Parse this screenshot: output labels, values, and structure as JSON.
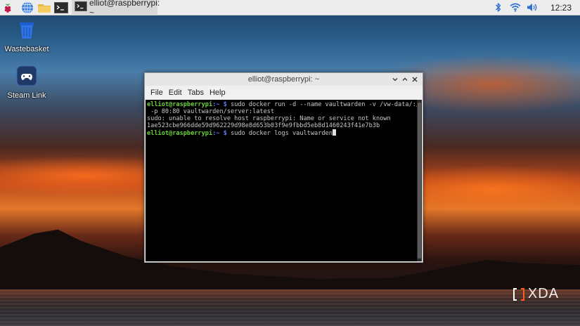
{
  "taskbar": {
    "launchers": [
      {
        "icon": "raspberry-menu-icon"
      },
      {
        "icon": "web-browser-icon"
      },
      {
        "icon": "file-manager-icon"
      },
      {
        "icon": "terminal-icon"
      }
    ],
    "task": {
      "label": "elliot@raspberrypi: ~",
      "icon": "terminal-icon"
    },
    "tray": {
      "bluetooth_icon": "bluetooth-icon",
      "wifi_icon": "wifi-icon",
      "volume_icon": "volume-icon"
    },
    "clock": "12:23"
  },
  "desktop": {
    "icons": [
      {
        "label": "Wastebasket",
        "icon": "wastebasket-icon"
      },
      {
        "label": "Steam Link",
        "icon": "steam-link-icon"
      }
    ]
  },
  "terminal": {
    "title": "elliot@raspberrypi: ~",
    "menu": [
      "File",
      "Edit",
      "Tabs",
      "Help"
    ],
    "lines": [
      {
        "type": "prompt",
        "user": "elliot@raspberrypi",
        "path": ":~ $ ",
        "cmd": "sudo docker run -d --name vaultwarden -v /vw-data/:/data/"
      },
      {
        "type": "out",
        "text": " -p 80:80 vaultwarden/server:latest"
      },
      {
        "type": "out",
        "text": "sudo: unable to resolve host raspberrypi: Name or service not known"
      },
      {
        "type": "out",
        "text": "1ae523cbe966dde59d962229d98e8d653b03f9e9fbbd5eb8d1460243f41e7b3b"
      },
      {
        "type": "prompt",
        "user": "elliot@raspberrypi",
        "path": ":~ $ ",
        "cmd": "sudo docker logs vaultwarden"
      }
    ]
  },
  "watermark": {
    "text": "XDA"
  },
  "colors": {
    "prompt_user": "#6bd23a",
    "prompt_path": "#5d7cf0",
    "terminal_bg": "#000000"
  }
}
